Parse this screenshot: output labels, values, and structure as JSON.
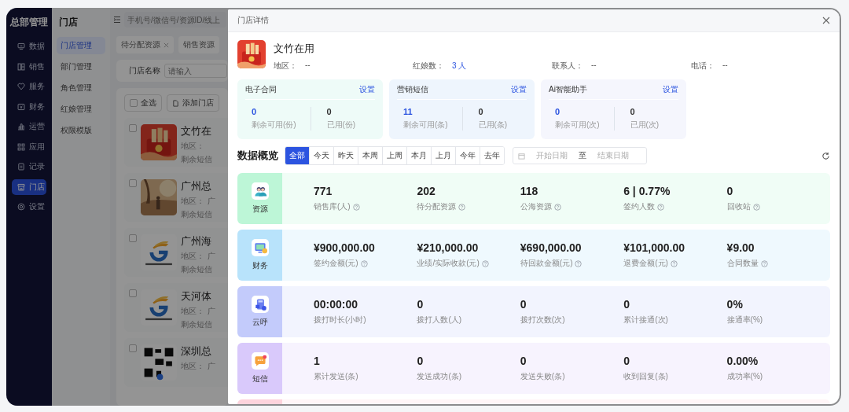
{
  "app": {
    "title": "总部管理"
  },
  "sidebar": {
    "items": [
      {
        "label": "数据",
        "selected": false
      },
      {
        "label": "销售",
        "selected": false
      },
      {
        "label": "服务",
        "selected": false
      },
      {
        "label": "财务",
        "selected": false
      },
      {
        "label": "运营",
        "selected": false
      },
      {
        "label": "应用",
        "selected": false
      },
      {
        "label": "记录",
        "selected": false
      },
      {
        "label": "门店",
        "selected": true
      },
      {
        "label": "设置",
        "selected": false
      }
    ]
  },
  "subnav": {
    "title": "门店",
    "items": [
      {
        "label": "门店管理",
        "selected": true
      },
      {
        "label": "部门管理",
        "selected": false
      },
      {
        "label": "角色管理",
        "selected": false
      },
      {
        "label": "红娘管理",
        "selected": false
      },
      {
        "label": "权限模版",
        "selected": false
      }
    ]
  },
  "topbar": {
    "search": {
      "placeholder": "手机号/微信号/资源ID/线上"
    }
  },
  "tabs": [
    {
      "label": "待分配资源",
      "closable": true
    },
    {
      "label": "销售资源",
      "closable": false
    }
  ],
  "filter": {
    "label": "门店名称",
    "placeholder": "请输入"
  },
  "list_actions": {
    "select_all": {
      "label": "全选",
      "checked": false
    },
    "add_button": "添加门店"
  },
  "stores": [
    {
      "name": "文竹在",
      "region_label": "地区：",
      "sms_label": "剩余短信",
      "checked": false
    },
    {
      "name": "广州总",
      "region_label": "地区：",
      "region": "广",
      "sms_label": "剩余短信",
      "checked": false
    },
    {
      "name": "广州海",
      "region_label": "地区：",
      "region": "广",
      "sms_label": "剩余短信",
      "checked": false
    },
    {
      "name": "天河体",
      "region_label": "地区：",
      "region": "广",
      "sms_label": "剩余短信",
      "checked": false
    },
    {
      "name": "深圳总",
      "region_label": "地区：",
      "region": "广",
      "checked": false
    }
  ],
  "drawer": {
    "title": "门店详情",
    "store": {
      "name": "文竹在用",
      "fields": [
        {
          "label": "地区：",
          "value": "--",
          "highlight": false
        },
        {
          "label": "红娘数：",
          "value": "3 人",
          "highlight": true
        },
        {
          "label": "联系人：",
          "value": "--",
          "highlight": false
        },
        {
          "label": "电话：",
          "value": "--",
          "highlight": false
        }
      ]
    },
    "quota_cards": [
      {
        "title": "电子合同",
        "action": "设置",
        "color": "#eefbf8",
        "stats": [
          {
            "value": "0",
            "label": "剩余可用(份)"
          },
          {
            "value": "0",
            "label": "已用(份)"
          }
        ]
      },
      {
        "title": "营销短信",
        "action": "设置",
        "color": "#eef5fd",
        "stats": [
          {
            "value": "11",
            "label": "剩余可用(条)"
          },
          {
            "value": "0",
            "label": "已用(条)"
          }
        ]
      },
      {
        "title": "Ai智能助手",
        "action": "设置",
        "color": "#f5f6fd",
        "stats": [
          {
            "value": "0",
            "label": "剩余可用(次)"
          },
          {
            "value": "0",
            "label": "已用(次)"
          }
        ]
      }
    ],
    "overview": {
      "title": "数据概览",
      "ranges": [
        {
          "label": "全部",
          "selected": true
        },
        {
          "label": "今天",
          "selected": false
        },
        {
          "label": "昨天",
          "selected": false
        },
        {
          "label": "本周",
          "selected": false
        },
        {
          "label": "上周",
          "selected": false
        },
        {
          "label": "本月",
          "selected": false
        },
        {
          "label": "上月",
          "selected": false
        },
        {
          "label": "今年",
          "selected": false
        },
        {
          "label": "去年",
          "selected": false
        }
      ],
      "date_range": {
        "start_placeholder": "开始日期",
        "separator": "至",
        "end_placeholder": "结束日期"
      }
    },
    "stat_rows": [
      {
        "label": "资源",
        "color": "#bdf6d7",
        "metrics": [
          {
            "value": "771",
            "label": "销售库(人)",
            "help": true
          },
          {
            "value": "202",
            "label": "待分配资源",
            "help": true
          },
          {
            "value": "118",
            "label": "公海资源",
            "help": true
          },
          {
            "value": "6 | 0.77%",
            "label": "签约人数",
            "help": true
          },
          {
            "value": "0",
            "label": "回收站",
            "help": true
          }
        ]
      },
      {
        "label": "财务",
        "color": "#b8e3fb",
        "metrics": [
          {
            "value": "¥900,000.00",
            "label": "签约金额(元)",
            "help": true
          },
          {
            "value": "¥210,000.00",
            "label": "业绩/实际收款(元)",
            "help": true
          },
          {
            "value": "¥690,000.00",
            "label": "待回款金额(元)",
            "help": true
          },
          {
            "value": "¥101,000.00",
            "label": "退费金额(元)",
            "help": true
          },
          {
            "value": "¥9.00",
            "label": "合同数量",
            "help": true
          }
        ]
      },
      {
        "label": "云呼",
        "color": "#c3cbfb",
        "metrics": [
          {
            "value": "00:00:00",
            "label": "拨打时长(小时)",
            "help": false
          },
          {
            "value": "0",
            "label": "拨打人数(人)",
            "help": false
          },
          {
            "value": "0",
            "label": "拨打次数(次)",
            "help": false
          },
          {
            "value": "0",
            "label": "累计接通(次)",
            "help": false
          },
          {
            "value": "0%",
            "label": "接通率(%)",
            "help": false
          }
        ]
      },
      {
        "label": "短信",
        "color": "#d9c9fb",
        "metrics": [
          {
            "value": "1",
            "label": "累计发送(条)",
            "help": false
          },
          {
            "value": "0",
            "label": "发送成功(条)",
            "help": false
          },
          {
            "value": "0",
            "label": "发送失败(条)",
            "help": false
          },
          {
            "value": "0",
            "label": "收到回复(条)",
            "help": false
          },
          {
            "value": "0.00%",
            "label": "成功率(%)",
            "help": false
          }
        ]
      },
      {
        "color": "#fdd3dc"
      }
    ]
  }
}
